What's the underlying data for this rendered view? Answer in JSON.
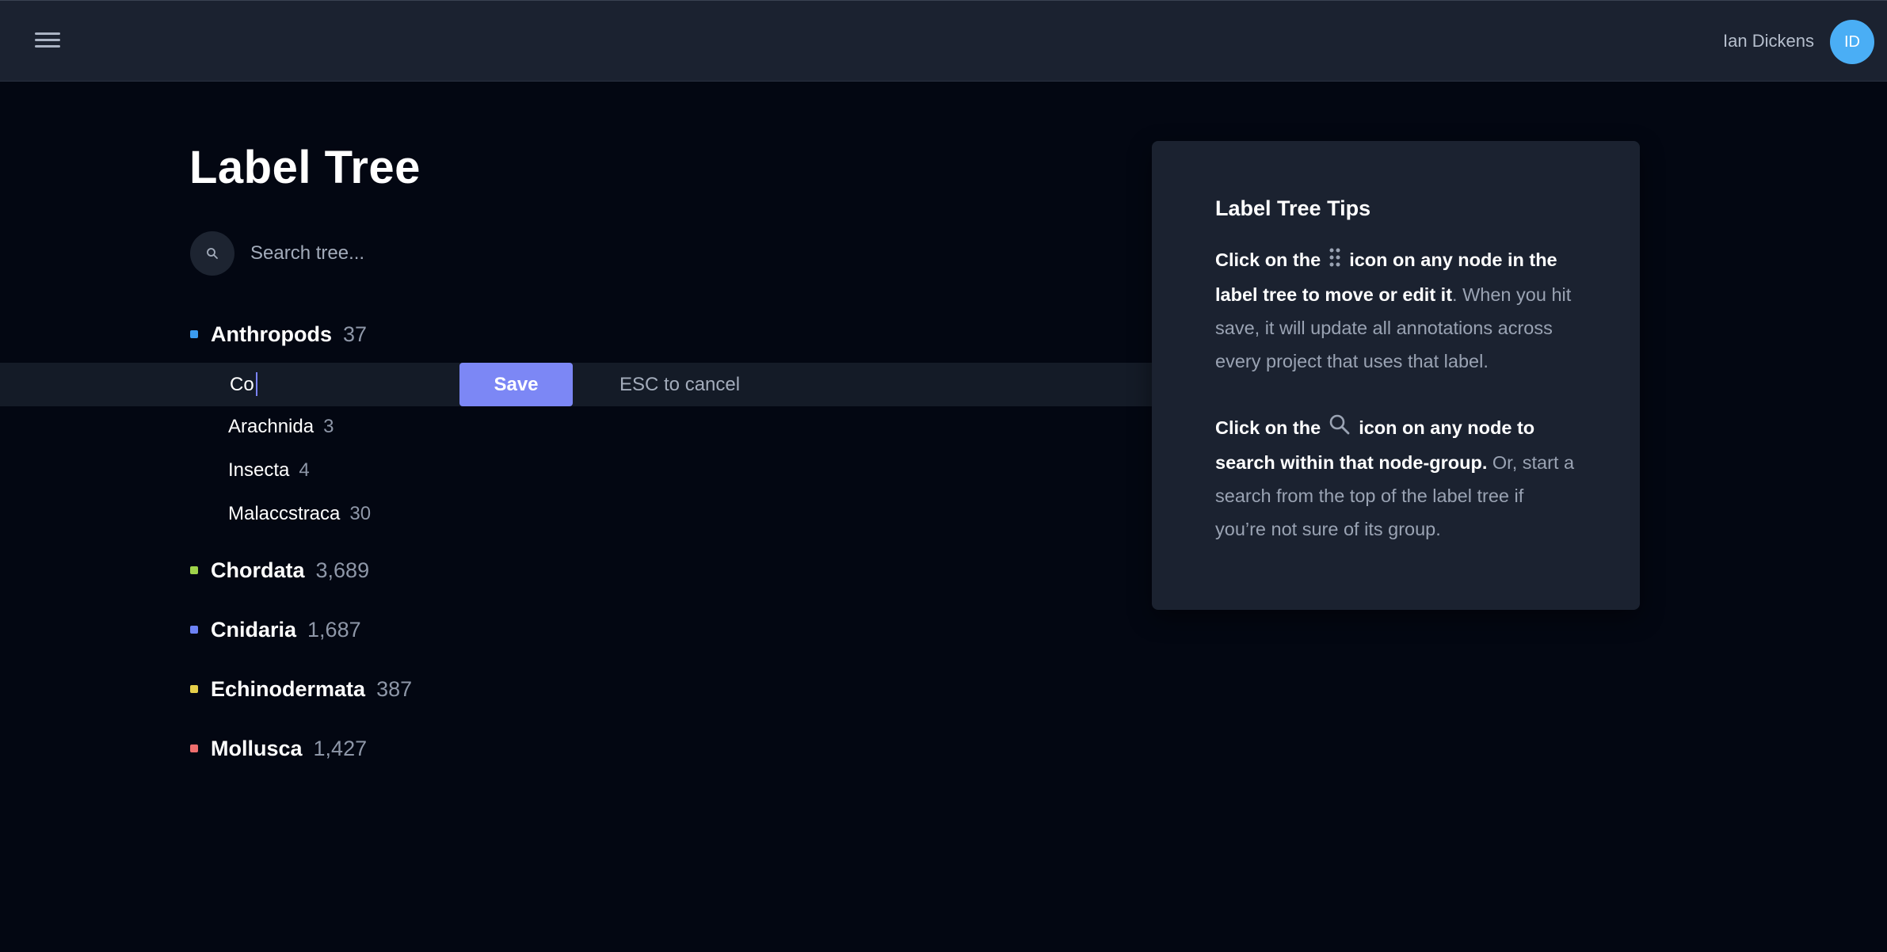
{
  "header": {
    "user_name": "Ian Dickens",
    "avatar_initials": "ID"
  },
  "page": {
    "title": "Label Tree"
  },
  "search": {
    "placeholder": "Search tree..."
  },
  "tree": {
    "roots": [
      {
        "label": "Anthropods",
        "count": "37",
        "color": "#3b9cf0"
      },
      {
        "label": "Chordata",
        "count": "3,689",
        "color": "#9fd34a"
      },
      {
        "label": "Cnidaria",
        "count": "1,687",
        "color": "#6d82f5"
      },
      {
        "label": "Echinodermata",
        "count": "387",
        "color": "#e5cf4a"
      },
      {
        "label": "Mollusca",
        "count": "1,427",
        "color": "#ee6e6e"
      }
    ],
    "children": [
      {
        "label": "Arachnida",
        "count": "3"
      },
      {
        "label": "Insecta",
        "count": "4"
      },
      {
        "label": "Malaccstraca",
        "count": "30"
      }
    ]
  },
  "edit": {
    "value": "Co",
    "save_label": "Save",
    "cancel_hint": "ESC to cancel"
  },
  "tips": {
    "title": "Label Tree Tips",
    "tip1_bold_a": "Click on the",
    "tip1_bold_b": "icon on any node in the label tree to move or edit it",
    "tip1_rest": ". When you hit save, it will update all annotations across every project that uses that label.",
    "tip1_icon": "drag-handle-icon",
    "tip2_bold_a": "Click on the",
    "tip2_bold_b": "icon on any node to search within that node-group.",
    "tip2_rest": " Or, start a search from the top of the label tree if you’re not sure of its group.",
    "tip2_icon": "search-icon"
  }
}
